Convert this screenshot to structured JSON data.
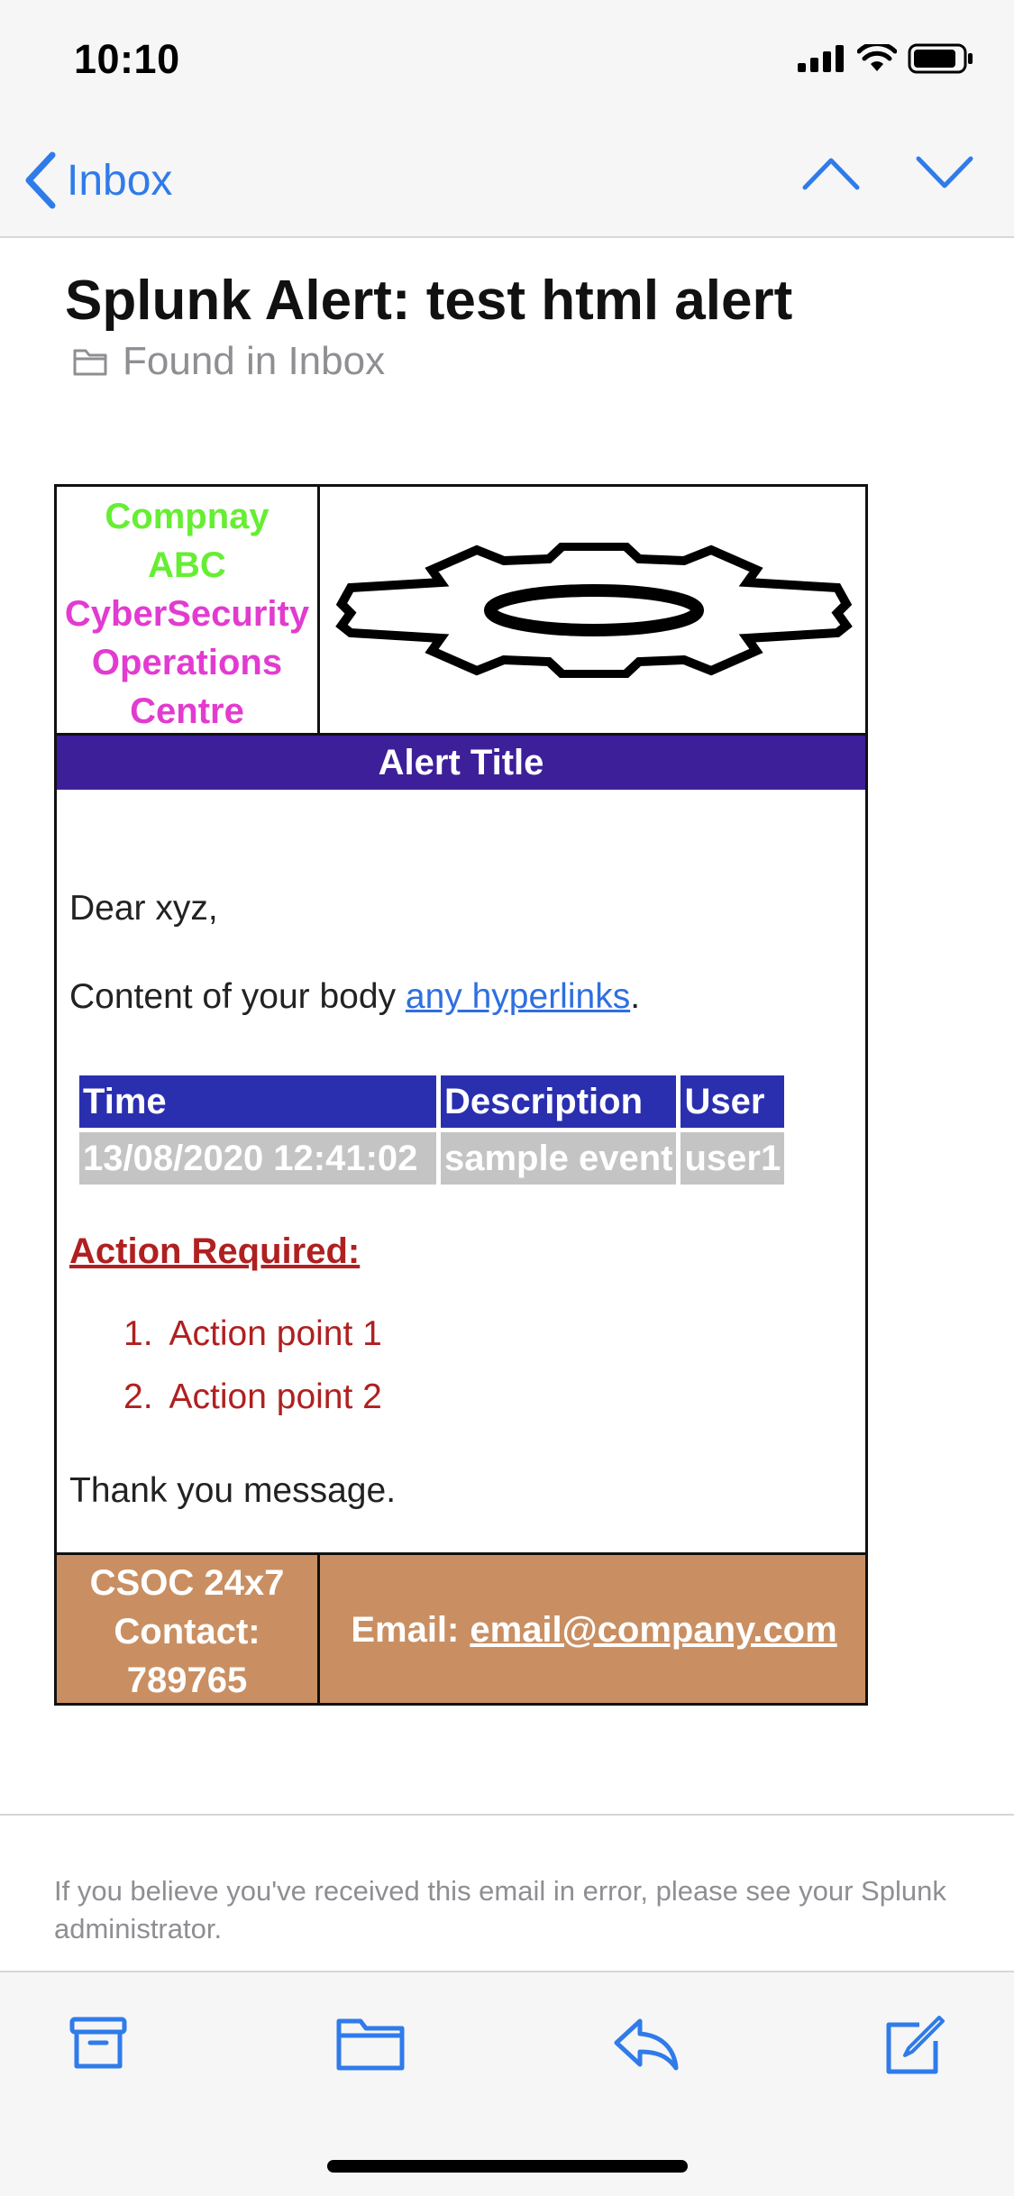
{
  "status_bar": {
    "time": "10:10"
  },
  "nav": {
    "back_label": "Inbox"
  },
  "header": {
    "subject": "Splunk Alert: test html alert",
    "location": "Found in Inbox"
  },
  "email": {
    "org_lines_green": [
      "Compnay",
      "ABC"
    ],
    "org_lines_pink": [
      "CyberSecurity",
      "Operations",
      "Centre"
    ],
    "alert_title": "Alert Title",
    "greeting": "Dear xyz,",
    "content_prefix": "Content of your body ",
    "content_link": "any hyperlinks",
    "content_suffix": ".",
    "table": {
      "headers": [
        "Time",
        "Description",
        "User"
      ],
      "rows": [
        [
          "13/08/2020 12:41:02",
          "sample event",
          "user1"
        ]
      ]
    },
    "action_heading": "Action Required:",
    "actions": [
      {
        "num": "1.",
        "text": "Action point 1"
      },
      {
        "num": "2.",
        "text": "Action point 2"
      }
    ],
    "thanks": "Thank you message.",
    "footer": {
      "contact_lines": [
        "CSOC 24x7",
        "Contact:",
        "789765"
      ],
      "email_label": "Email:",
      "email_value": "email@company.com"
    }
  },
  "disclaimer": "If you believe you've received this email in error, please see your Splunk administrator.",
  "colors": {
    "accent": "#2f7bea",
    "alert_title_bg": "#3d1f99",
    "table_header_bg": "#2a2fb0",
    "table_cell_bg": "#c4c4c4",
    "action_red": "#b02020",
    "footer_bg": "#c98f62"
  },
  "icons": {
    "toolbar": [
      "archive-icon",
      "folder-icon",
      "reply-icon",
      "compose-icon"
    ],
    "nav": [
      "chevron-left-icon",
      "chevron-up-icon",
      "chevron-down-icon"
    ]
  }
}
